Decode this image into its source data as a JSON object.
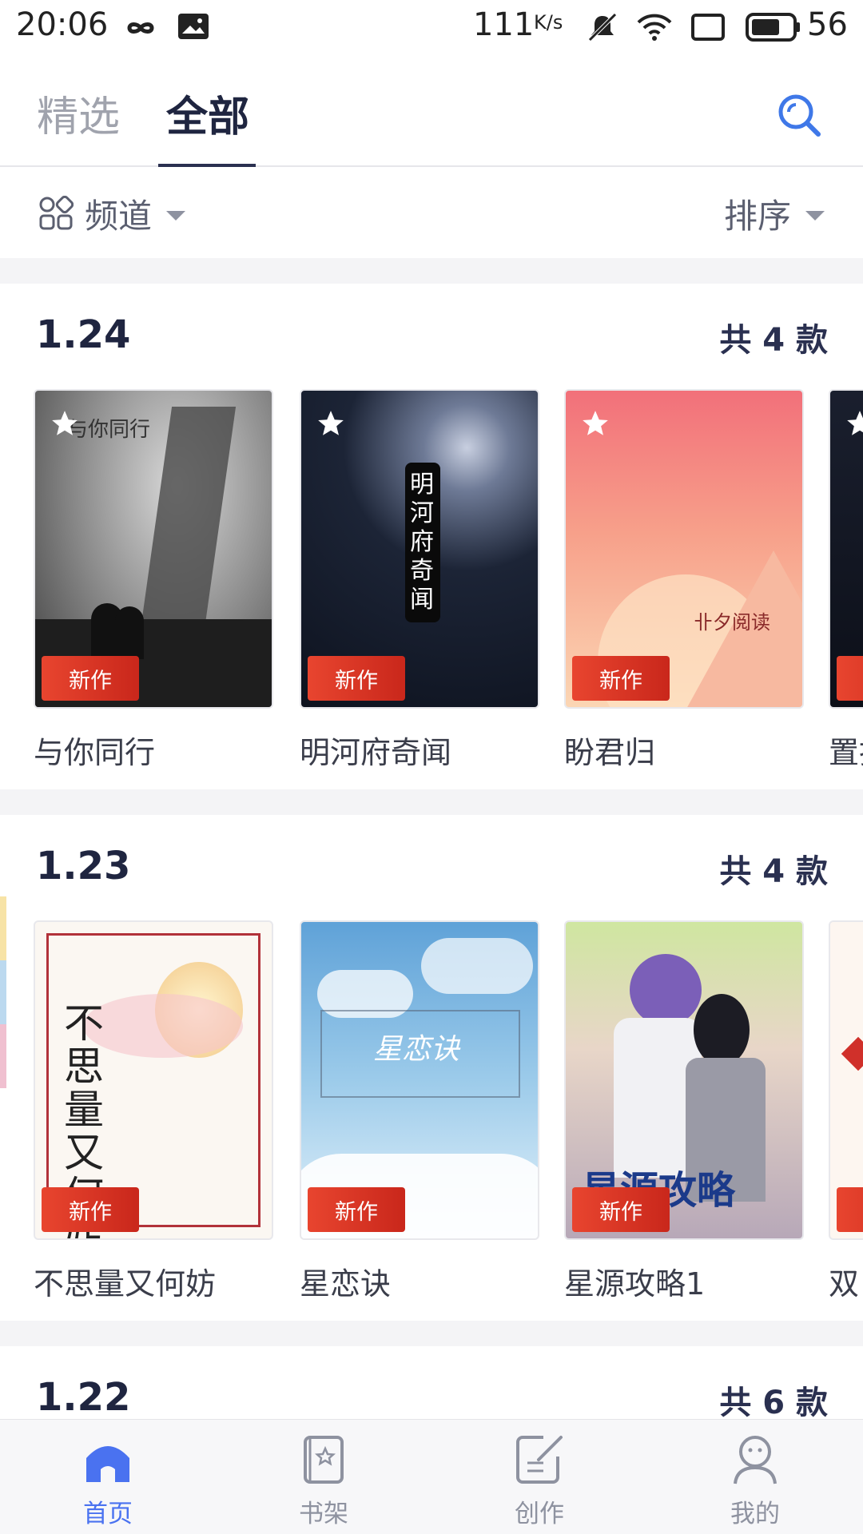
{
  "status_bar": {
    "time": "20:06",
    "net_speed": "111",
    "net_unit": "K/s",
    "battery": "56"
  },
  "top_tabs": {
    "featured": "精选",
    "all": "全部"
  },
  "filter": {
    "channel": "频道",
    "sort": "排序"
  },
  "sections": [
    {
      "date": "1.24",
      "count": "共 4 款",
      "books": [
        {
          "title": "与你同行",
          "badge": "新作",
          "cover_text": "与你同行"
        },
        {
          "title": "明河府奇闻",
          "badge": "新作",
          "cover_text": "明河府奇闻"
        },
        {
          "title": "盼君归",
          "badge": "新作",
          "cover_text": "卝夕阅读"
        },
        {
          "title": "置拔",
          "badge": "新作",
          "cover_text": ""
        }
      ]
    },
    {
      "date": "1.23",
      "count": "共 4 款",
      "books": [
        {
          "title": "不思量又何妨",
          "badge": "新作",
          "cover_text": "不思量又何妨"
        },
        {
          "title": "星恋诀",
          "badge": "新作",
          "cover_text": "星恋诀"
        },
        {
          "title": "星源攻略1",
          "badge": "新作",
          "cover_text": "星源攻略"
        },
        {
          "title": "双"
        }
      ]
    },
    {
      "date": "1.22",
      "count": "共 6 款"
    }
  ],
  "bottom_nav": [
    {
      "label": "首页",
      "icon": "home-icon",
      "active": true
    },
    {
      "label": "书架",
      "icon": "bookshelf-icon",
      "active": false
    },
    {
      "label": "创作",
      "icon": "create-icon",
      "active": false
    },
    {
      "label": "我的",
      "icon": "profile-icon",
      "active": false
    }
  ],
  "colors": {
    "accent": "#4a72f0",
    "badge": "#d7321f",
    "title": "#1f2540"
  }
}
